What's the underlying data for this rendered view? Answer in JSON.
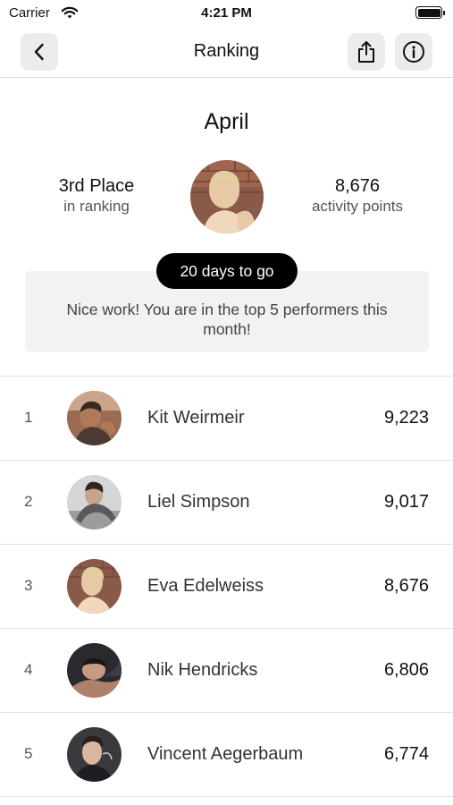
{
  "status_bar": {
    "carrier": "Carrier",
    "time": "4:21 PM",
    "icons": [
      "wifi-icon",
      "battery-icon"
    ]
  },
  "nav": {
    "title": "Ranking",
    "back_icon": "chevron-left-icon",
    "share_icon": "share-icon",
    "info_icon": "info-icon"
  },
  "summary": {
    "month": "April",
    "place": "3rd Place",
    "place_caption": "in ranking",
    "points": "8,676",
    "points_caption": "activity points",
    "countdown": "20 days to go",
    "message": "Nice work! You are in the top 5 performers this month!"
  },
  "ranking": [
    {
      "rank": "1",
      "name": "Kit Weirmeir",
      "points": "9,223"
    },
    {
      "rank": "2",
      "name": "Liel Simpson",
      "points": "9,017"
    },
    {
      "rank": "3",
      "name": "Eva Edelweiss",
      "points": "8,676"
    },
    {
      "rank": "4",
      "name": "Nik Hendricks",
      "points": "6,806"
    },
    {
      "rank": "5",
      "name": "Vincent Aegerbaum",
      "points": "6,774"
    }
  ],
  "colors": {
    "button_bg": "#ececec",
    "badge_bg": "#000000",
    "notice_bg": "#f2f2f2",
    "divider": "#e0e0e0"
  }
}
